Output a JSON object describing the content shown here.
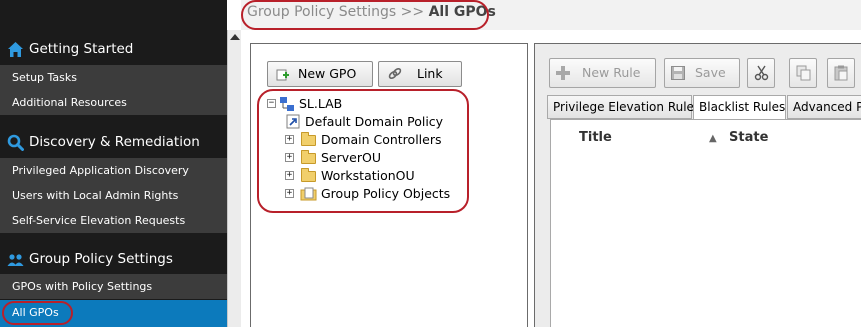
{
  "nav": {
    "sections": [
      {
        "title": "Getting Started",
        "icon": "home-icon",
        "items": [
          {
            "label": "Setup Tasks"
          },
          {
            "label": "Additional Resources"
          }
        ]
      },
      {
        "title": "Discovery & Remediation",
        "icon": "search-icon",
        "items": [
          {
            "label": "Privileged Application Discovery"
          },
          {
            "label": "Users with Local Admin Rights"
          },
          {
            "label": "Self-Service Elevation Requests"
          }
        ]
      },
      {
        "title": "Group Policy Settings",
        "icon": "users-icon",
        "items": [
          {
            "label": "GPOs with Policy Settings"
          },
          {
            "label": "All GPOs",
            "selected": true
          }
        ]
      }
    ],
    "selected_color": "#0c7abc"
  },
  "breadcrumb": {
    "parent": "Group Policy Settings",
    "separator": ">>",
    "current": "All GPOs"
  },
  "tree_toolbar": {
    "new_gpo_label": "New GPO",
    "link_label": "Link"
  },
  "tree": {
    "root": "SL.LAB",
    "children": [
      {
        "label": "Default Domain Policy",
        "icon": "gpo-link-icon"
      },
      {
        "label": "Domain Controllers",
        "icon": "folder-icon"
      },
      {
        "label": "ServerOU",
        "icon": "folder-icon"
      },
      {
        "label": "WorkstationOU",
        "icon": "folder-icon"
      },
      {
        "label": "Group Policy Objects",
        "icon": "gpo-container-icon"
      }
    ]
  },
  "rules_toolbar": {
    "new_rule_label": "New Rule",
    "save_label": "Save"
  },
  "tabs": [
    {
      "label": "Privilege Elevation Rules"
    },
    {
      "label": "Blacklist Rules",
      "active": true
    },
    {
      "label": "Advanced Po"
    }
  ],
  "grid": {
    "columns": [
      "Title",
      "State"
    ]
  },
  "colors": {
    "highlight_ring": "#b8202a",
    "nav_background": "#1b1b1b",
    "nav_item_background": "#3c3c3c"
  }
}
